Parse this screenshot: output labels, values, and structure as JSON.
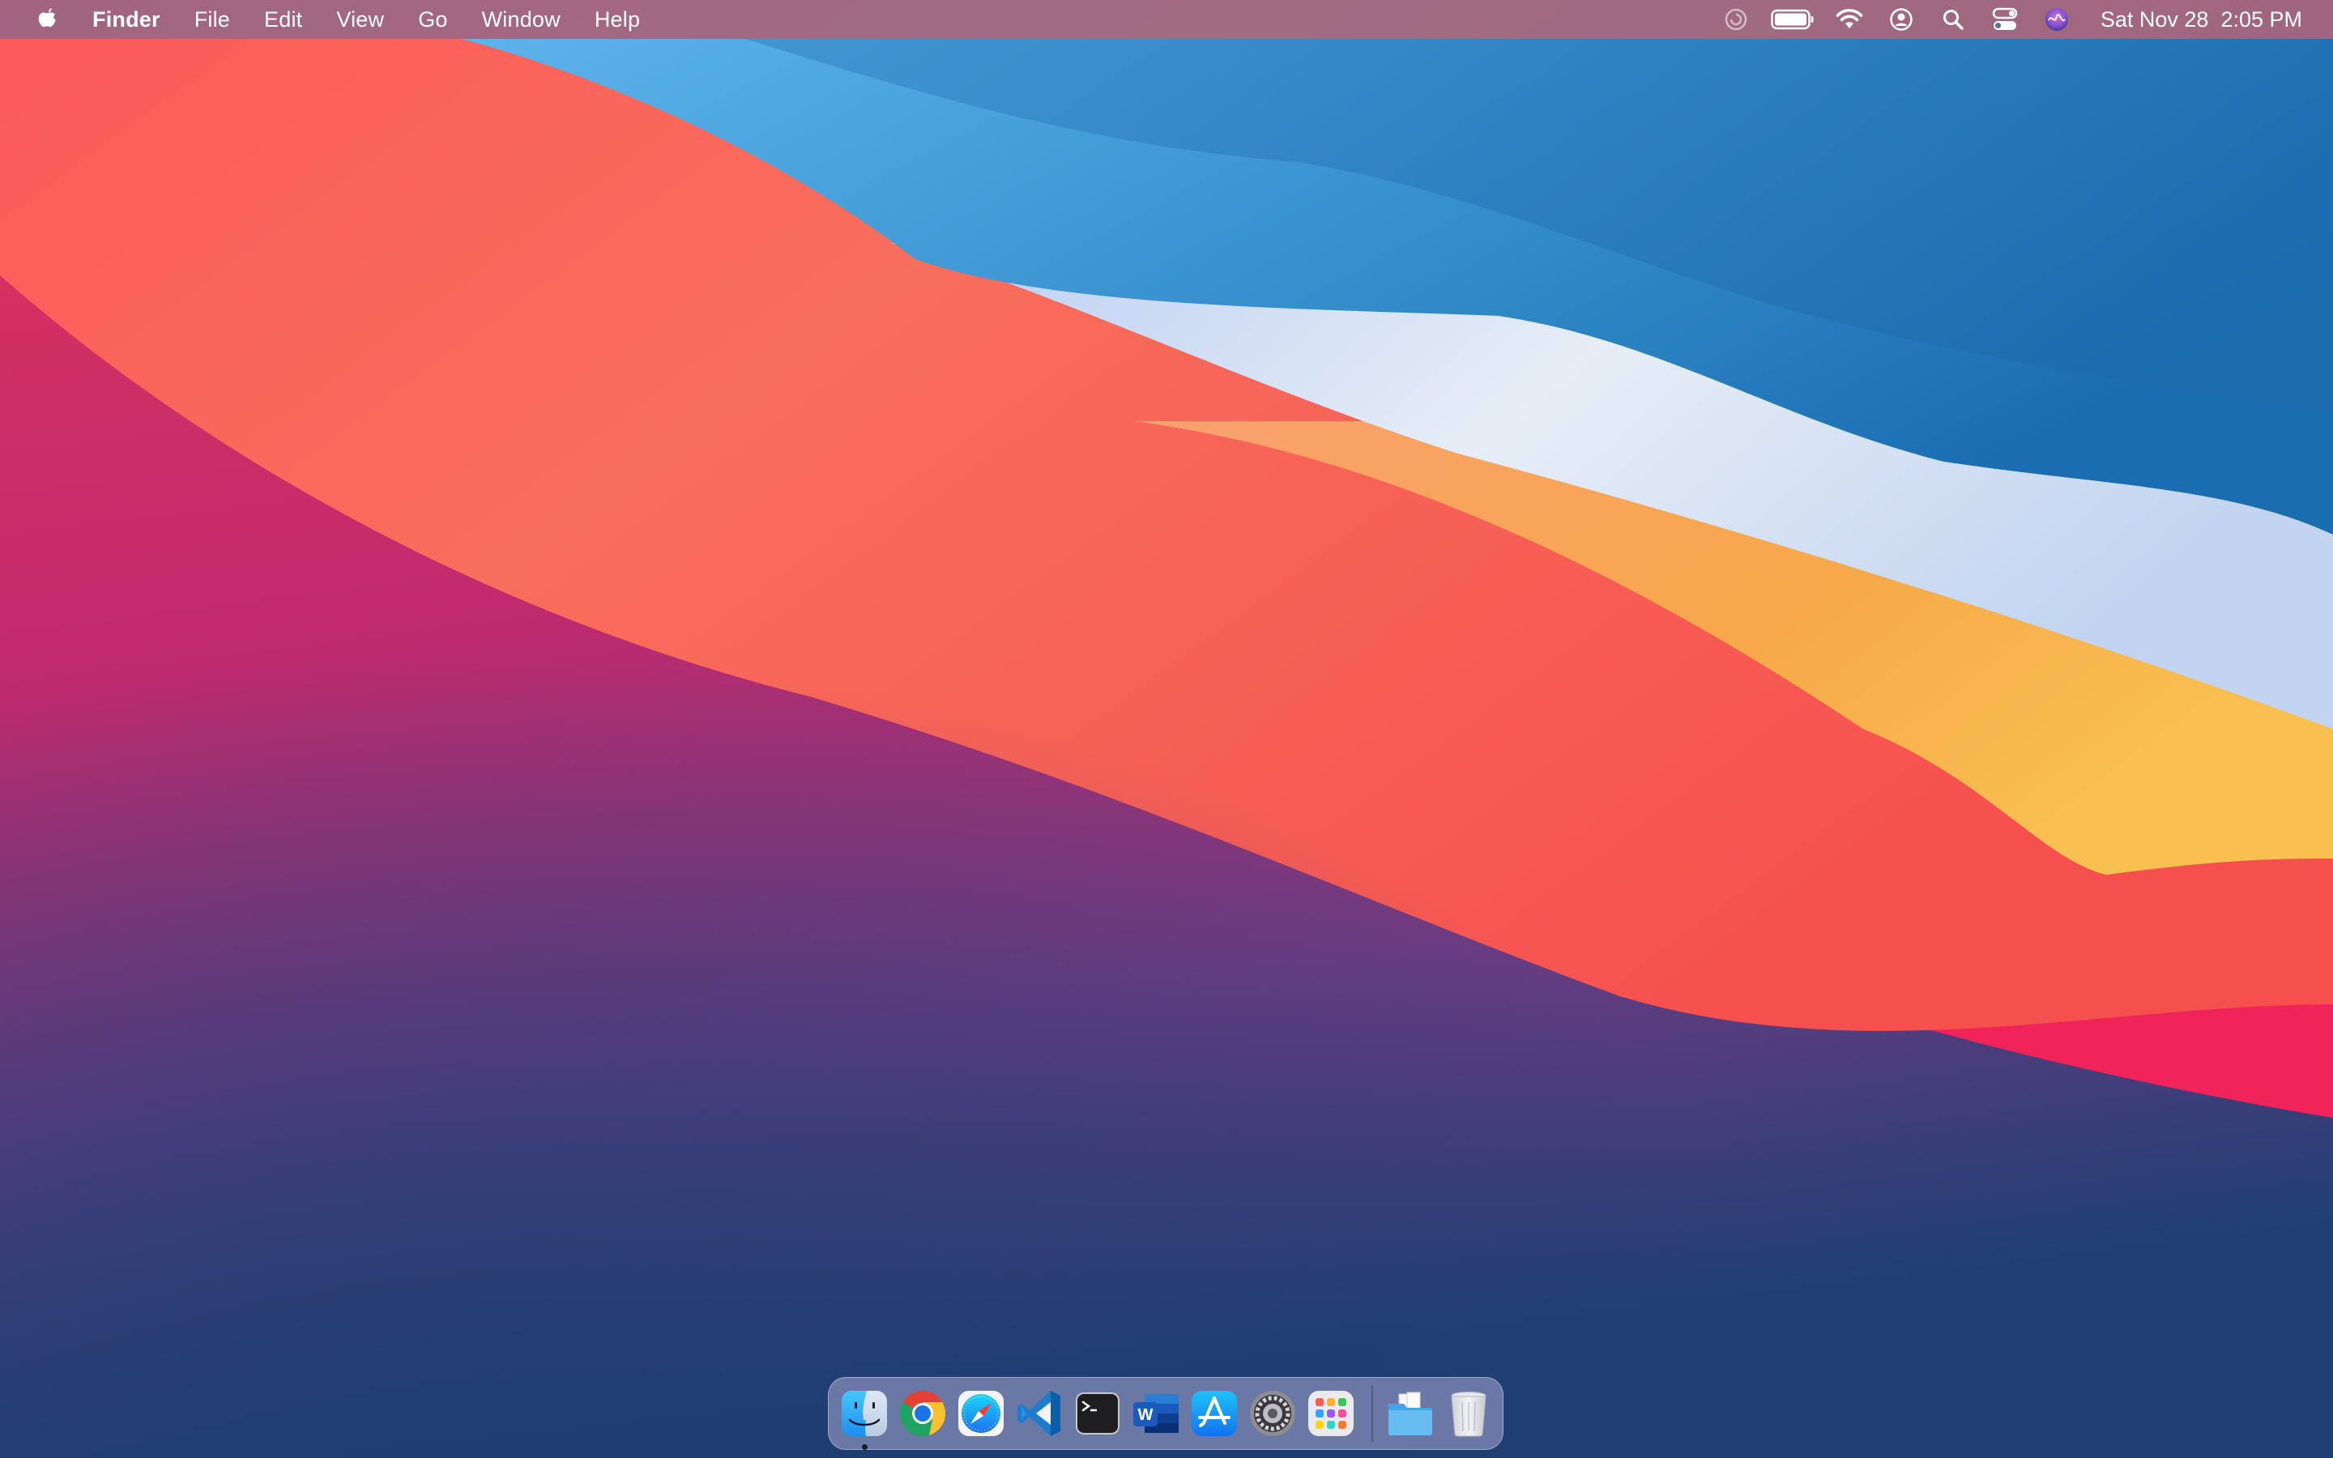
{
  "menubar": {
    "apple_icon": "apple-logo-icon",
    "app_name": "Finder",
    "menus": [
      "File",
      "Edit",
      "View",
      "Go",
      "Window",
      "Help"
    ],
    "status_icons": [
      "focus-moon-icon",
      "battery-icon",
      "wifi-icon",
      "user-account-icon",
      "spotlight-search-icon",
      "control-center-icon",
      "siri-icon"
    ],
    "clock": "Sat Nov 28  2:05 PM"
  },
  "dock": {
    "apps": [
      {
        "icon": "finder-icon",
        "running": true
      },
      {
        "icon": "chrome-icon",
        "running": false
      },
      {
        "icon": "safari-icon",
        "running": false
      },
      {
        "icon": "vscode-icon",
        "running": false
      },
      {
        "icon": "terminal-icon",
        "running": false
      },
      {
        "icon": "word-icon",
        "running": false
      },
      {
        "icon": "app-store-icon",
        "running": false
      },
      {
        "icon": "system-preferences-icon",
        "running": false
      },
      {
        "icon": "launchpad-icon",
        "running": false
      }
    ],
    "others": [
      {
        "icon": "downloads-folder-icon"
      },
      {
        "icon": "trash-icon"
      }
    ]
  },
  "colors": {
    "wallpaper_red": "#f2224a",
    "wallpaper_coral": "#f86a58",
    "wallpaper_orange": "#f7a84a",
    "wallpaper_blue": "#2275b8",
    "wallpaper_purple": "#6a3c82"
  }
}
